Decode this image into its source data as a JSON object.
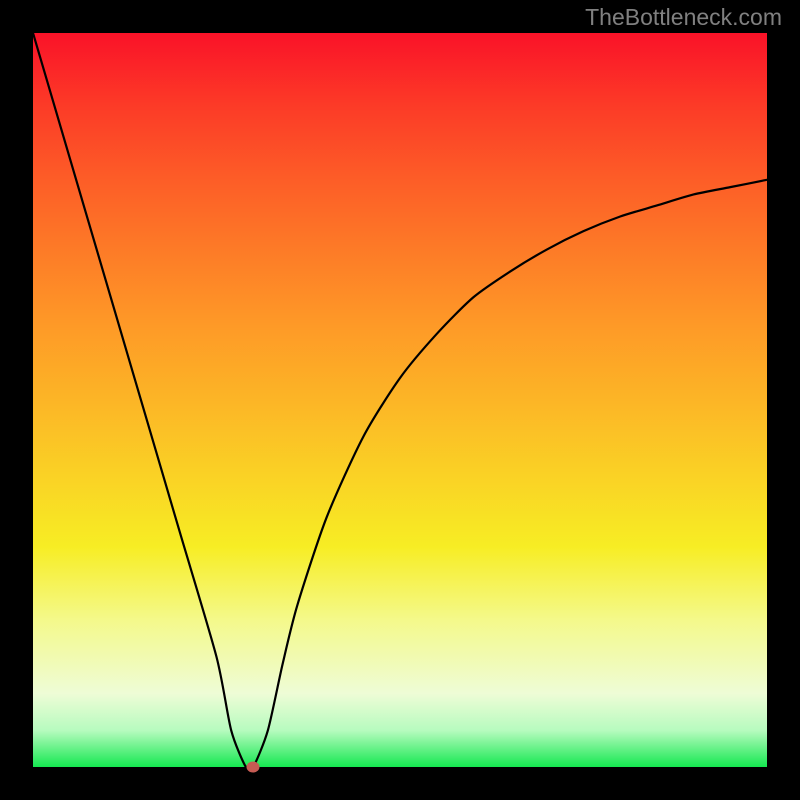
{
  "watermark": "TheBottleneck.com",
  "chart_data": {
    "type": "line",
    "title": "",
    "xlabel": "",
    "ylabel": "",
    "xlim": [
      0,
      100
    ],
    "ylim": [
      0,
      100
    ],
    "series": [
      {
        "name": "bottleneck-curve",
        "x": [
          0,
          5,
          10,
          15,
          20,
          25,
          27,
          29,
          30,
          32,
          34,
          36,
          40,
          45,
          50,
          55,
          60,
          65,
          70,
          75,
          80,
          85,
          90,
          95,
          100
        ],
        "values": [
          100,
          83,
          66,
          49,
          32,
          15,
          5,
          0,
          0,
          5,
          14,
          22,
          34,
          45,
          53,
          59,
          64,
          67.5,
          70.5,
          73,
          75,
          76.5,
          78,
          79,
          80
        ]
      }
    ],
    "marker": {
      "x": 30,
      "y": 0,
      "color": "#c65b53"
    },
    "gradient_stops": [
      {
        "pos": 0,
        "color": "#fa1228"
      },
      {
        "pos": 0.5,
        "color": "#fcb526"
      },
      {
        "pos": 0.7,
        "color": "#f7ed24"
      },
      {
        "pos": 1.0,
        "color": "#15e850"
      }
    ]
  }
}
